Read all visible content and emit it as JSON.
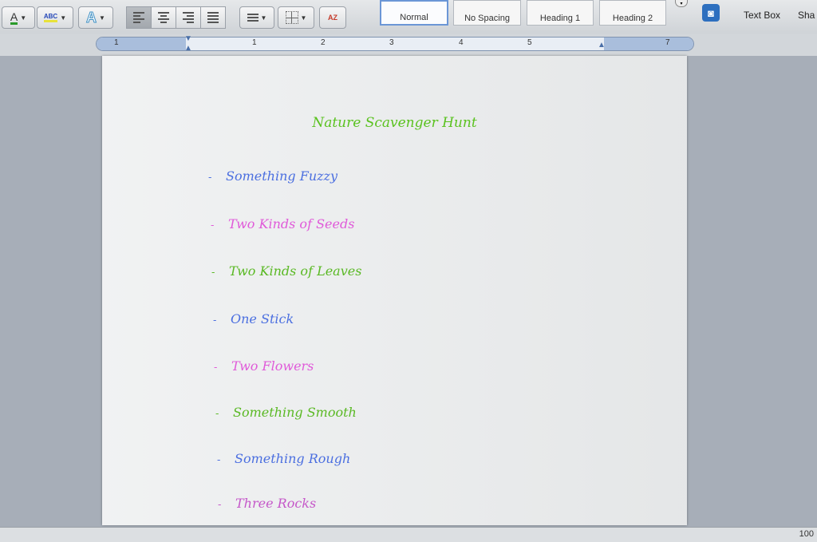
{
  "ribbon": {
    "font_color_glyph": "A",
    "highlight_glyph": "ABC",
    "text_effects_glyph": "A",
    "sort_glyph": "AZ",
    "styles": [
      "Normal",
      "No Spacing",
      "Heading 1",
      "Heading 2"
    ],
    "text_box_label": "Text Box",
    "shape_label": "Sha"
  },
  "ruler": {
    "numbers": [
      "1",
      "1",
      "2",
      "3",
      "4",
      "5",
      "7"
    ]
  },
  "document": {
    "title": "Nature Scavenger Hunt",
    "bullet": "-",
    "items": [
      {
        "text": "Something Fuzzy",
        "color": "#4b6fe0"
      },
      {
        "text": "Two Kinds of Seeds",
        "color": "#e05ad9"
      },
      {
        "text": "Two Kinds of Leaves",
        "color": "#5ab924"
      },
      {
        "text": "One Stick",
        "color": "#4b6fe0"
      },
      {
        "text": "Two Flowers",
        "color": "#e05ad9"
      },
      {
        "text": "Something Smooth",
        "color": "#5ab924"
      },
      {
        "text": "Something Rough",
        "color": "#4b6fe0"
      },
      {
        "text": "Three Rocks",
        "color": "#c557c9"
      }
    ]
  },
  "status": {
    "zoom": "100"
  }
}
